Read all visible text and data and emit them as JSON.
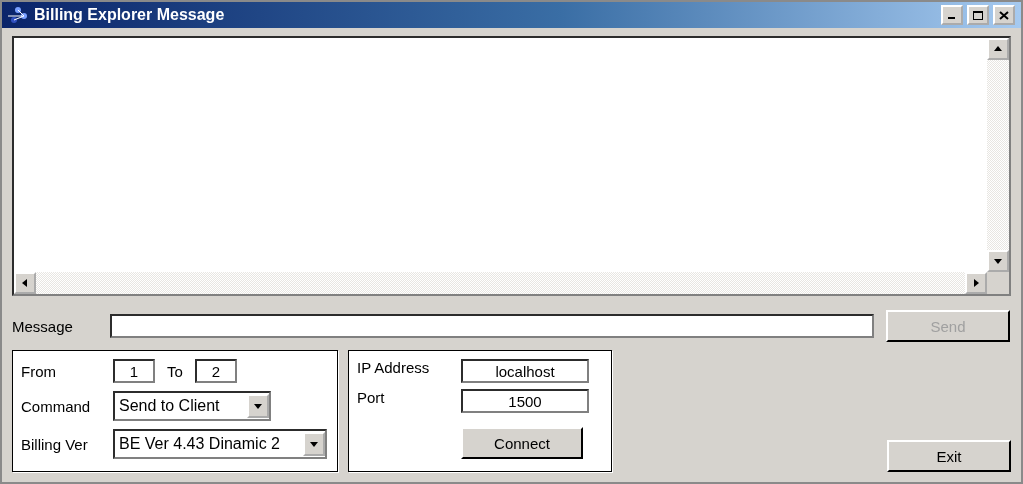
{
  "window": {
    "title": "Billing Explorer Message"
  },
  "message": {
    "label": "Message",
    "send": {
      "label": "Send",
      "disabled": true
    }
  },
  "routing": {
    "from": {
      "label": "From",
      "value": "1"
    },
    "to": {
      "label": "To",
      "value": "2"
    },
    "command": {
      "label": "Command",
      "value": "Send to Client"
    },
    "billing_ver": {
      "label": "Billing Ver",
      "value": "BE Ver 4.43 Dinamic 2"
    }
  },
  "connection": {
    "ip": {
      "label": "IP Address",
      "value": "localhost"
    },
    "port": {
      "label": "Port",
      "value": "1500"
    },
    "connect": {
      "label": "Connect",
      "disabled": false
    }
  },
  "exit": {
    "label": "Exit",
    "disabled": false
  }
}
